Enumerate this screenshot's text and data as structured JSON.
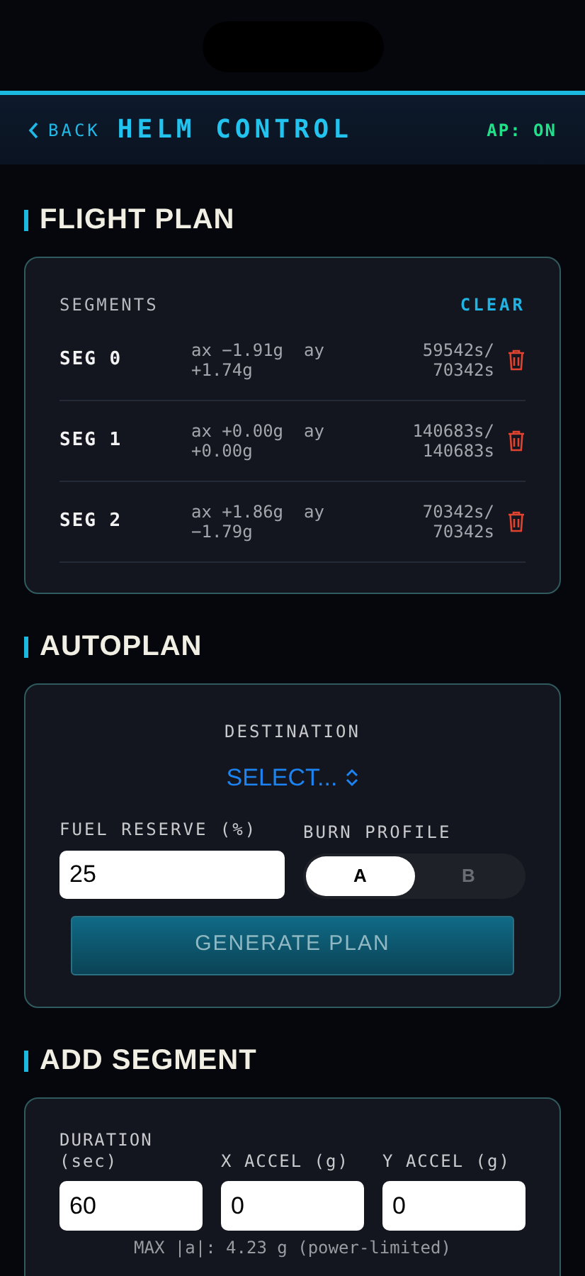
{
  "header": {
    "back": "BACK",
    "title": "HELM CONTROL",
    "autopilot": "AP: ON"
  },
  "flight_plan": {
    "title": "FLIGHT PLAN",
    "list_label": "SEGMENTS",
    "clear": "CLEAR",
    "segments": [
      {
        "name": "SEG 0",
        "accel": "ax −1.91g  ay +1.74g",
        "time": "59542s/ 70342s"
      },
      {
        "name": "SEG 1",
        "accel": "ax +0.00g  ay +0.00g",
        "time": "140683s/ 140683s"
      },
      {
        "name": "SEG 2",
        "accel": "ax +1.86g  ay −1.79g",
        "time": "70342s/ 70342s"
      }
    ]
  },
  "autoplan": {
    "title": "AUTOPLAN",
    "destination_label": "DESTINATION",
    "destination": "SELECT...",
    "fuel_label": "FUEL RESERVE (%)",
    "fuel_value": "25",
    "burn_label": "BURN PROFILE",
    "burn_options": [
      {
        "label": "A",
        "selected": true
      },
      {
        "label": "B",
        "selected": false
      }
    ],
    "generate": "GENERATE PLAN"
  },
  "add_segment": {
    "title": "ADD SEGMENT",
    "fields": [
      {
        "label": "DURATION (sec)",
        "value": "60"
      },
      {
        "label": "X ACCEL (g)",
        "value": "0"
      },
      {
        "label": "Y ACCEL (g)",
        "value": "0"
      }
    ],
    "note": "MAX |a|: 4.23 g (power-limited)"
  }
}
